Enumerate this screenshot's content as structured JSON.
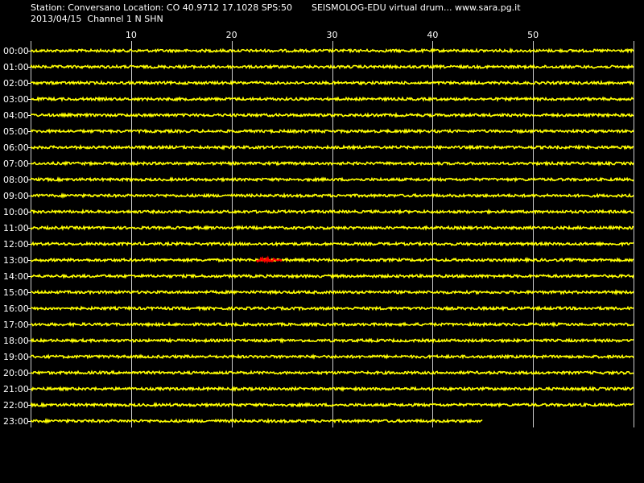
{
  "header": {
    "station_line": "Station: Conversano Location: CO 40.9712 17.1028 SPS:50",
    "product_line": "SEISMOLOG-EDU virtual drum... www.sara.pg.it",
    "date_line": "2013/04/15  Channel 1 N SHN"
  },
  "colors": {
    "background": "#000000",
    "trace": "#ffff00",
    "event": "#ff0000",
    "grid": "#ffffff",
    "text": "#ffffff"
  },
  "chart_data": {
    "type": "line",
    "title": "",
    "xlabel": "",
    "ylabel": "",
    "x_unit_minutes_range": [
      0,
      60
    ],
    "x_ticks": [
      10,
      20,
      30,
      40,
      50
    ],
    "x_grid_at": [
      0,
      10,
      20,
      30,
      40,
      50,
      60
    ],
    "rows": [
      "00:00",
      "01:00",
      "02:00",
      "03:00",
      "04:00",
      "05:00",
      "06:00",
      "07:00",
      "08:00",
      "09:00",
      "10:00",
      "11:00",
      "12:00",
      "13:00",
      "14:00",
      "15:00",
      "16:00",
      "17:00",
      "18:00",
      "19:00",
      "20:00",
      "21:00",
      "22:00",
      "23:00"
    ],
    "trace_end_minute": [
      60,
      60,
      60,
      60,
      60,
      60,
      60,
      60,
      60,
      60,
      60,
      60,
      60,
      60,
      60,
      60,
      60,
      60,
      60,
      60,
      60,
      60,
      60,
      45
    ],
    "events": [
      {
        "row": "13:00",
        "start_minute": 22.5,
        "end_minute": 25
      }
    ]
  }
}
